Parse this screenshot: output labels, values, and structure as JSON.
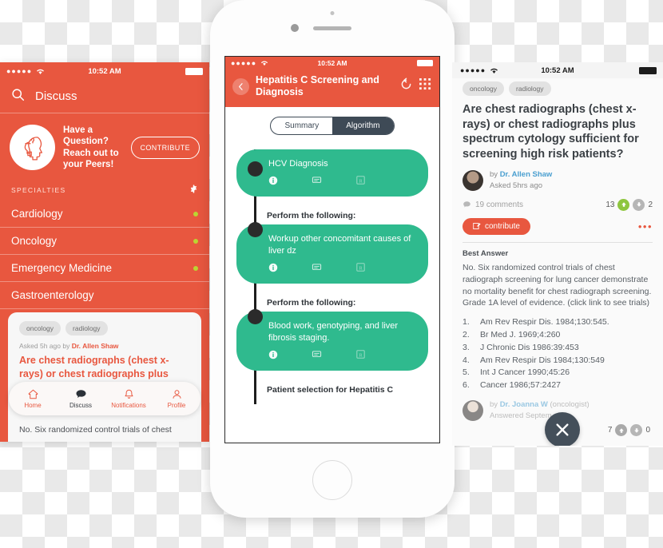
{
  "left_panel": {
    "status": {
      "signal": "●●●●●",
      "time": "10:52 AM"
    },
    "navbar": {
      "title": "Discuss",
      "search_icon": "search-icon"
    },
    "promo": {
      "line1": "Have a",
      "line2": "Question?",
      "line3": "Reach out to",
      "line4": "your Peers!",
      "button": "CONTRIBUTE"
    },
    "specialties_header": "SPECIALTIES",
    "specialties": [
      {
        "name": "Cardiology",
        "has_dot": true
      },
      {
        "name": "Oncology",
        "has_dot": true
      },
      {
        "name": "Emergency Medicine",
        "has_dot": true
      },
      {
        "name": "Gastroenterology",
        "has_dot": false
      }
    ],
    "card": {
      "tags": [
        "oncology",
        "radiology"
      ],
      "asked_prefix": "Asked 5h ago by ",
      "asked_author": "Dr. Allen Shaw",
      "question": "Are chest radiographs (chest x-rays) or chest radiographs plus spectrum cytology sufficient for screening high risk patients?",
      "answer_preview": "No.  Six randomized control trials of chest"
    },
    "tabbar": [
      {
        "label": "Home",
        "icon": "home-icon",
        "active": false
      },
      {
        "label": "Discuss",
        "icon": "chat-bubble-icon",
        "active": true
      },
      {
        "label": "Notifications",
        "icon": "bell-icon",
        "active": false
      },
      {
        "label": "Profile",
        "icon": "person-icon",
        "active": false
      }
    ]
  },
  "center_phone": {
    "status": {
      "time": "10:52 AM"
    },
    "header": {
      "title": "Hepatitis C Screening and Diagnosis",
      "back_icon": "chevron-left-icon",
      "reset_icon": "reset-arrow-icon",
      "grid_icon": "grid-menu-icon"
    },
    "segmented": {
      "options": [
        "Summary",
        "Algorithm"
      ],
      "selected": "Algorithm"
    },
    "steps": [
      {
        "caption": "",
        "text": "HCV Diagnosis",
        "icons": [
          "info-icon",
          "comment-icon",
          "rx-icon"
        ]
      },
      {
        "caption": "Perform the following:",
        "text": "Workup other concomitant causes of liver dz",
        "icons": [
          "info-icon",
          "comment-icon",
          "rx-icon"
        ]
      },
      {
        "caption": "Perform the following:",
        "text": "Blood work, genotyping, and liver fibrosis staging.",
        "icons": [
          "info-icon",
          "comment-icon",
          "rx-icon"
        ]
      }
    ],
    "next_caption": "Patient selection for Hepatitis C"
  },
  "right_panel": {
    "status": {
      "time": "10:52 AM"
    },
    "tags": [
      "oncology",
      "radiology"
    ],
    "question": "Are chest radiographs (chest x-rays) or chest radiographs plus spectrum cytology sufficient for screening high risk patients?",
    "author": {
      "by": "by ",
      "name": "Dr. Allen Shaw",
      "asked": "Asked 5hrs ago"
    },
    "comments": "19 comments",
    "upvotes": "13",
    "downvotes": "2",
    "contribute_button": "contribute",
    "more_icon": "more-horizontal-icon",
    "best_answer_label": "Best Answer",
    "answer": "No.  Six randomized control trials of chest radiograph screening for lung cancer demonstrate no mortality benefit for chest radiograph screening.  Grade 1A level of evidence. (click link to see trials)",
    "references": [
      {
        "n": "1.",
        "text": "Am Rev Respir Dis. 1984;130:545."
      },
      {
        "n": "2.",
        "text": "Br Med J. 1969;4:260"
      },
      {
        "n": "3.",
        "text": "J Chronic Dis 1986:39:453"
      },
      {
        "n": "4.",
        "text": "Am Rev Respir Dis 1984;130:549"
      },
      {
        "n": "5.",
        "text": "Int J Cancer 1990;45:26"
      },
      {
        "n": "6.",
        "text": "Cancer 1986;57:2427"
      }
    ],
    "answer_author": {
      "by": "by ",
      "name": "Dr. Joanna W",
      "role": "(oncologist)",
      "answered": "Answered Septem"
    },
    "answer_upvotes": "7",
    "answer_downvotes": "0",
    "close_icon": "close-x-icon"
  },
  "colors": {
    "brand_orange": "#E8573F",
    "algorithm_green": "#2FBA8E",
    "slate": "#3E4A56",
    "upvote_green": "#8ec63f",
    "downvote_grey": "#b6b6b6",
    "dot_olive": "#bcd432",
    "link_blue": "#4a9fd0"
  }
}
